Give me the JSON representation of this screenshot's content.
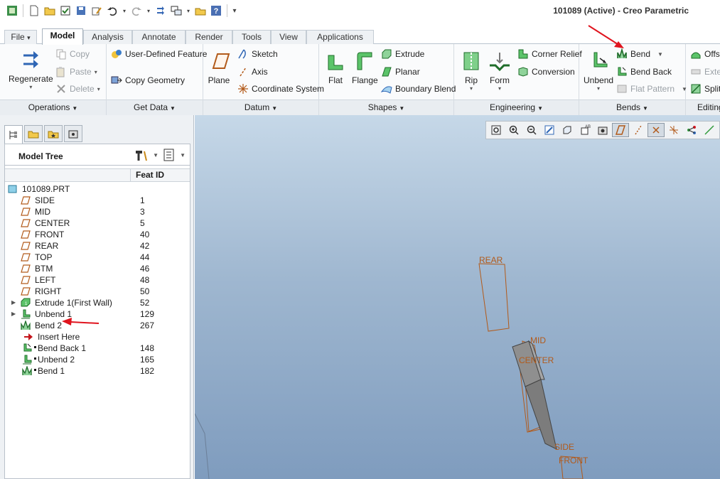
{
  "window": {
    "title": "101089 (Active) - Creo Parametric"
  },
  "tabs": [
    {
      "label": "File",
      "caret": "▾"
    },
    {
      "label": "Model"
    },
    {
      "label": "Analysis"
    },
    {
      "label": "Annotate"
    },
    {
      "label": "Render"
    },
    {
      "label": "Tools"
    },
    {
      "label": "View"
    },
    {
      "label": "Applications"
    }
  ],
  "ribbon": {
    "operations": {
      "label": "Operations",
      "regenerate": "Regenerate",
      "copy": "Copy",
      "paste": "Paste",
      "delete": "Delete"
    },
    "getdata": {
      "label": "Get Data",
      "udf": "User-Defined Feature",
      "copy_geometry": "Copy Geometry"
    },
    "datum": {
      "label": "Datum",
      "plane": "Plane",
      "sketch": "Sketch",
      "axis": "Axis",
      "coordinate_system": "Coordinate System"
    },
    "shapes": {
      "label": "Shapes",
      "flat": "Flat",
      "flange": "Flange",
      "extrude": "Extrude",
      "planar": "Planar",
      "boundary_blend": "Boundary Blend"
    },
    "engineering": {
      "label": "Engineering",
      "rip": "Rip",
      "form": "Form",
      "corner_relief": "Corner Relief",
      "conversion": "Conversion"
    },
    "bends": {
      "label": "Bends",
      "unbend": "Unbend",
      "bend": "Bend",
      "bend_back": "Bend Back",
      "flat_pattern": "Flat Pattern"
    },
    "editing": {
      "label": "Editing",
      "offset": "Offse",
      "extend": "Exte",
      "split": "Split"
    }
  },
  "model_tree": {
    "title": "Model Tree",
    "column": "Feat ID",
    "items": [
      {
        "label": "101089.PRT",
        "id": "",
        "icon": "part-icon"
      },
      {
        "label": "SIDE",
        "id": "1",
        "icon": "datum-plane-icon"
      },
      {
        "label": "MID",
        "id": "3",
        "icon": "datum-plane-icon"
      },
      {
        "label": "CENTER",
        "id": "5",
        "icon": "datum-plane-icon"
      },
      {
        "label": "FRONT",
        "id": "40",
        "icon": "datum-plane-icon"
      },
      {
        "label": "REAR",
        "id": "42",
        "icon": "datum-plane-icon"
      },
      {
        "label": "TOP",
        "id": "44",
        "icon": "datum-plane-icon"
      },
      {
        "label": "BTM",
        "id": "46",
        "icon": "datum-plane-icon"
      },
      {
        "label": "LEFT",
        "id": "48",
        "icon": "datum-plane-icon"
      },
      {
        "label": "RIGHT",
        "id": "50",
        "icon": "datum-plane-icon"
      },
      {
        "label": "Extrude 1(First Wall)",
        "id": "52",
        "icon": "extrude-wall-icon"
      },
      {
        "label": "Unbend 1",
        "id": "129",
        "icon": "unbend-icon"
      },
      {
        "label": "Bend 2",
        "id": "267",
        "icon": "bend-icon"
      },
      {
        "label": "Insert Here",
        "id": "",
        "icon": "insert-here-arrow-icon"
      },
      {
        "label": "Bend Back 1",
        "id": "148",
        "icon": "bend-back-icon"
      },
      {
        "label": "Unbend 2",
        "id": "165",
        "icon": "unbend-icon"
      },
      {
        "label": "Bend 1",
        "id": "182",
        "icon": "bend-icon"
      }
    ]
  },
  "viewport": {
    "labels": {
      "rear": "REAR",
      "mid": "MID",
      "center": "CENTER",
      "side": "SIDE",
      "front": "FRONT"
    }
  },
  "colors": {
    "datum": "#b25a1a",
    "annotation_arrow": "#e0141e",
    "ribbon_icon_green": "#2f9a3a"
  }
}
